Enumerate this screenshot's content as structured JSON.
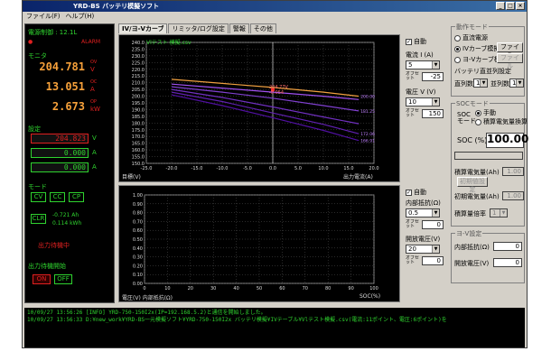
{
  "window": {
    "title": "YRD-BS バッテリ模擬ソフト"
  },
  "menu": [
    "ファイル(F)",
    "ヘルプ(H)"
  ],
  "left": {
    "power_label": "電源制御 : 12.1L",
    "alarm_label": "ALARM",
    "monitor_label": "モニタ",
    "monitor_values": [
      "204.781",
      "13.051",
      "2.673"
    ],
    "monitor_units": [
      "V",
      "A",
      "kW"
    ],
    "monitor_sub": [
      "OV",
      "OC",
      "OP"
    ],
    "setting_label": "設定",
    "setting_values": [
      "204.823",
      "0.000",
      "0.000"
    ],
    "setting_units": [
      "V",
      "A",
      "A"
    ],
    "mode_label": "モード",
    "mode_buttons": [
      "CV",
      "CC",
      "CP"
    ],
    "clr_label": "CLR",
    "ah_value": "-0.721 Ah",
    "kwh_value": "0.114 kWh",
    "fault_label": "出力待機中",
    "output_label": "出力待機開始",
    "on_label": "ON",
    "off_label": "OFF"
  },
  "tabs": [
    "IV/ヨ-Vカーブ",
    "リミッタ/ログ設定",
    "警報",
    "その他"
  ],
  "chart1": {
    "file_label": "Vlテスト 模擬.csv",
    "annotation": [
      "204.77V",
      "-0.054"
    ],
    "bottom_left": "目標(V)",
    "bottom_right": "出力電流(A)"
  },
  "chart2": {
    "bottom_left": "電圧(V) 内部抵抗(Ω)",
    "bottom_right": "SOC(%)"
  },
  "chart_data": [
    {
      "type": "line",
      "title": "",
      "xlabel": "出力電流(A)",
      "ylabel": "目標(V)",
      "xlim": [
        -25,
        20
      ],
      "ylim": [
        150,
        240
      ],
      "x_ticks": [
        "-25.0",
        "-20.0",
        "-15.0",
        "-10.0",
        "-5.0",
        "0.0",
        "5.0",
        "10.0",
        "15.0",
        "20.0"
      ],
      "y_ticks": [
        "240.0",
        "235.0",
        "230.0",
        "225.0",
        "220.0",
        "215.0",
        "210.0",
        "205.0",
        "200.0",
        "195.0",
        "190.0",
        "185.0",
        "180.0",
        "175.0",
        "170.0",
        "165.0",
        "160.0",
        "155.0",
        "150.0"
      ],
      "series": [
        {
          "color": "#f0a040",
          "x": [
            -20,
            -10,
            0,
            10,
            17
          ],
          "y": [
            212.5,
            209.5,
            206.5,
            203,
            200
          ]
        },
        {
          "color": "#a050f0",
          "x": [
            -20,
            -10,
            0,
            10,
            17
          ],
          "y": [
            209,
            206,
            203,
            200,
            197.5
          ]
        },
        {
          "color": "#8040d0",
          "x": [
            -20,
            -10,
            0,
            10,
            17
          ],
          "y": [
            207,
            203,
            198.5,
            193,
            189
          ]
        },
        {
          "color": "#7030c0",
          "x": [
            -20,
            -10,
            0,
            10,
            17
          ],
          "y": [
            205,
            199,
            192,
            184.5,
            179.5
          ]
        },
        {
          "color": "#6020b0",
          "x": [
            -20,
            -10,
            0,
            10,
            17
          ],
          "y": [
            203,
            196,
            187.5,
            179,
            172
          ]
        },
        {
          "color": "#5010a0",
          "x": [
            -20,
            -10,
            0,
            10,
            17
          ],
          "y": [
            201,
            193,
            184,
            174.5,
            167
          ]
        }
      ],
      "end_labels": [
        "200.00",
        "",
        "181.25",
        "",
        "172.06",
        "166.91"
      ],
      "marker": {
        "x": 0,
        "y": 204.77
      }
    },
    {
      "type": "line",
      "title": "",
      "xlabel": "SOC(%)",
      "ylabel": "電圧(V) 内部抵抗(Ω)",
      "xlim": [
        0,
        100
      ],
      "ylim": [
        0,
        1
      ],
      "x_ticks": [
        "0",
        "10",
        "20",
        "30",
        "40",
        "50",
        "60",
        "70",
        "80",
        "90",
        "100"
      ],
      "y_ticks": [
        "1.00",
        "0.90",
        "0.80",
        "0.70",
        "0.60",
        "0.50",
        "0.40",
        "0.30",
        "0.20",
        "0.10",
        "0.00"
      ],
      "series": []
    }
  ],
  "ctrl1": {
    "auto_label": "自動",
    "current_label": "電流 I (A)",
    "current_value": "5",
    "current_off_label": "オフセット",
    "current_off_value": "-25",
    "voltage_label": "電圧 V (V)",
    "voltage_value": "10",
    "voltage_off_label": "オフセット",
    "voltage_off_value": "150"
  },
  "ctrl2": {
    "auto_label": "自動",
    "resist_label": "内部抵抗(Ω)",
    "resist_value": "0.5",
    "resist_off_label": "オフセット",
    "resist_off_value": "0",
    "ocv_label": "開放電圧(V)",
    "ocv_value": "20",
    "ocv_off_label": "オフセット",
    "ocv_off_value": "0"
  },
  "right": {
    "mode_group": "動作モード",
    "mode_options": [
      "直流電源",
      "IVカーブ模擬",
      "ヨ-Vカーブ模擬"
    ],
    "file_button": "ファイル",
    "series_group": "バッテリ直並列設定",
    "series_label": "直列数",
    "series_value": "1",
    "parallel_label": "並列数",
    "parallel_value": "1",
    "soc_group": "SOCモード",
    "soc_mode_label": "SOC モード",
    "soc_opts": [
      "手動",
      "積算電気量換算"
    ],
    "soc_label": "SOC (%)",
    "soc_value": "100.00",
    "accum_label": "積算電気量(Ah)",
    "accum_value": "1.00",
    "init_button": "初期値設定",
    "initial_label": "初期電気量(Ah)",
    "initial_value": "1.00",
    "rate_label": "積算量倍率",
    "rate_value": "1",
    "iv_group": "ヨ-V設定",
    "internal_label": "内部抵抗(Ω)",
    "internal_value": "0",
    "open_label": "開放電圧(V)",
    "open_value": "0"
  },
  "log": [
    "10/09/27 13:56:26 [INFO] YRD-750-150I2x(IP=192.168.5.2)と通信を開始しました。",
    "10/09/27 13:56:33 D:¥new_work¥YRD-BS一元模擬ソフト¥YRD-750-150I2x バッテリ模擬¥IVテーブル¥Vlテスト模擬.csv(電流:11ポイント、電圧:6ポイント)を"
  ]
}
